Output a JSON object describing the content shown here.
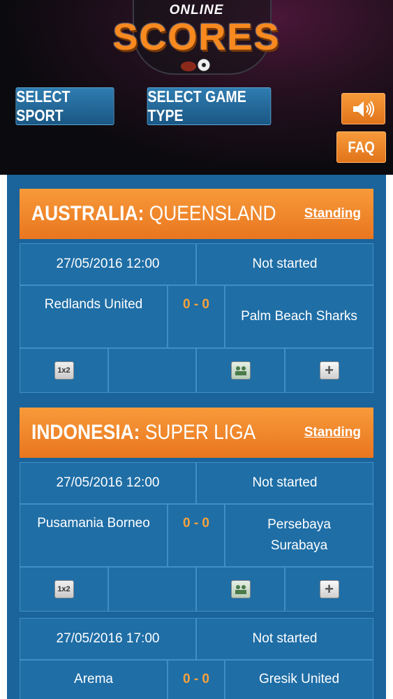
{
  "header": {
    "logo_top": "ONLINE",
    "logo_main": "SCORES",
    "select_sport": "SELECT SPORT",
    "select_game_type": "SELECT GAME TYPE",
    "faq": "FAQ",
    "sound_icon": "speaker-icon"
  },
  "colors": {
    "accent": "#f7891f",
    "board": "#1a639b",
    "cell": "#1f6ea6",
    "score": "#f7a23a"
  },
  "leagues": [
    {
      "country": "AUSTRALIA:",
      "name": "QUEENSLAND",
      "standing": "Standing",
      "matches": [
        {
          "datetime": "27/05/2016 12:00",
          "status": "Not started",
          "home": "Redlands United",
          "score": "0 - 0",
          "away": "Palm Beach Sharks"
        }
      ]
    },
    {
      "country": "INDONESIA:",
      "name": "SUPER LIGA",
      "standing": "Standing",
      "matches": [
        {
          "datetime": "27/05/2016 12:00",
          "status": "Not started",
          "home": "Pusamania Borneo",
          "score": "0 - 0",
          "away": "Persebaya Surabaya"
        },
        {
          "datetime": "27/05/2016 17:00",
          "status": "Not started",
          "home": "Arema",
          "score": "0 - 0",
          "away": "Gresik United"
        }
      ]
    }
  ],
  "icons": {
    "odds": "odds-1x2-icon",
    "lineup": "lineup-icon",
    "more": "plus-icon",
    "odds_label": "1x2"
  }
}
